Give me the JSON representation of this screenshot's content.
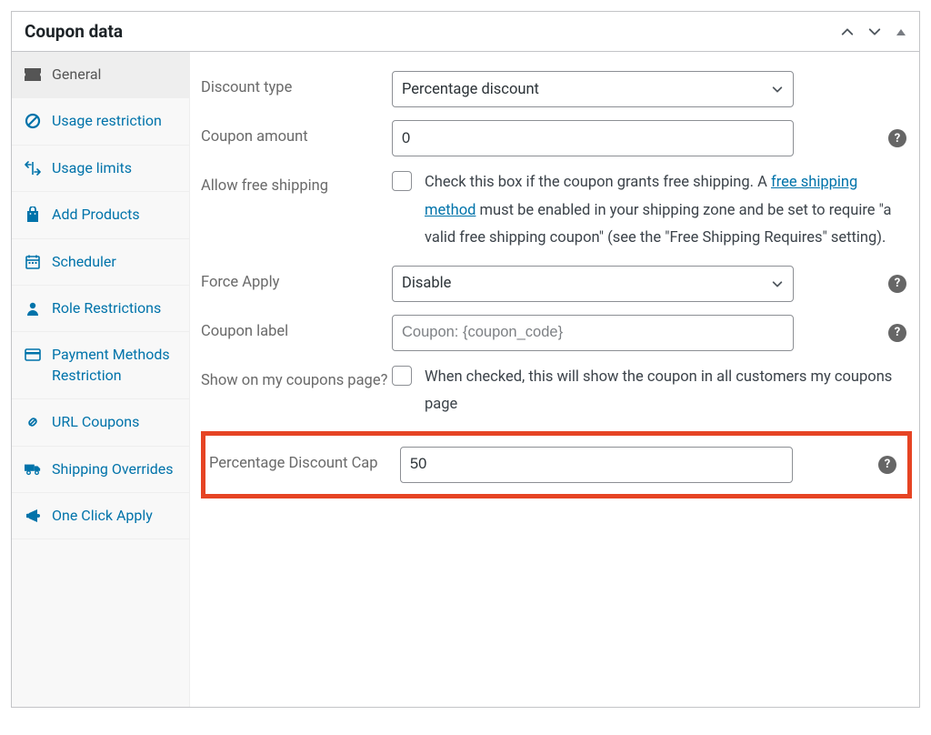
{
  "panel": {
    "title": "Coupon data"
  },
  "sidebar": {
    "items": [
      {
        "label": "General"
      },
      {
        "label": "Usage restriction"
      },
      {
        "label": "Usage limits"
      },
      {
        "label": "Add Products"
      },
      {
        "label": "Scheduler"
      },
      {
        "label": "Role Restrictions"
      },
      {
        "label": "Payment Methods Restriction"
      },
      {
        "label": "URL Coupons"
      },
      {
        "label": "Shipping Overrides"
      },
      {
        "label": "One Click Apply"
      }
    ]
  },
  "fields": {
    "discount_type": {
      "label": "Discount type",
      "value": "Percentage discount"
    },
    "coupon_amount": {
      "label": "Coupon amount",
      "value": "0"
    },
    "free_shipping": {
      "label": "Allow free shipping",
      "desc_1": "Check this box if the coupon grants free shipping. A ",
      "link_text": "free shipping method",
      "desc_2": " must be enabled in your shipping zone and be set to require \"a valid free shipping coupon\" (see the \"Free Shipping Requires\" setting)."
    },
    "force_apply": {
      "label": "Force Apply",
      "value": "Disable"
    },
    "coupon_label": {
      "label": "Coupon label",
      "placeholder": "Coupon: {coupon_code}"
    },
    "show_my_coupons": {
      "label": "Show on my coupons page?",
      "desc": "When checked, this will show the coupon in all customers my coupons page"
    },
    "discount_cap": {
      "label": "Percentage Discount Cap",
      "value": "50"
    }
  },
  "help_glyph": "?"
}
